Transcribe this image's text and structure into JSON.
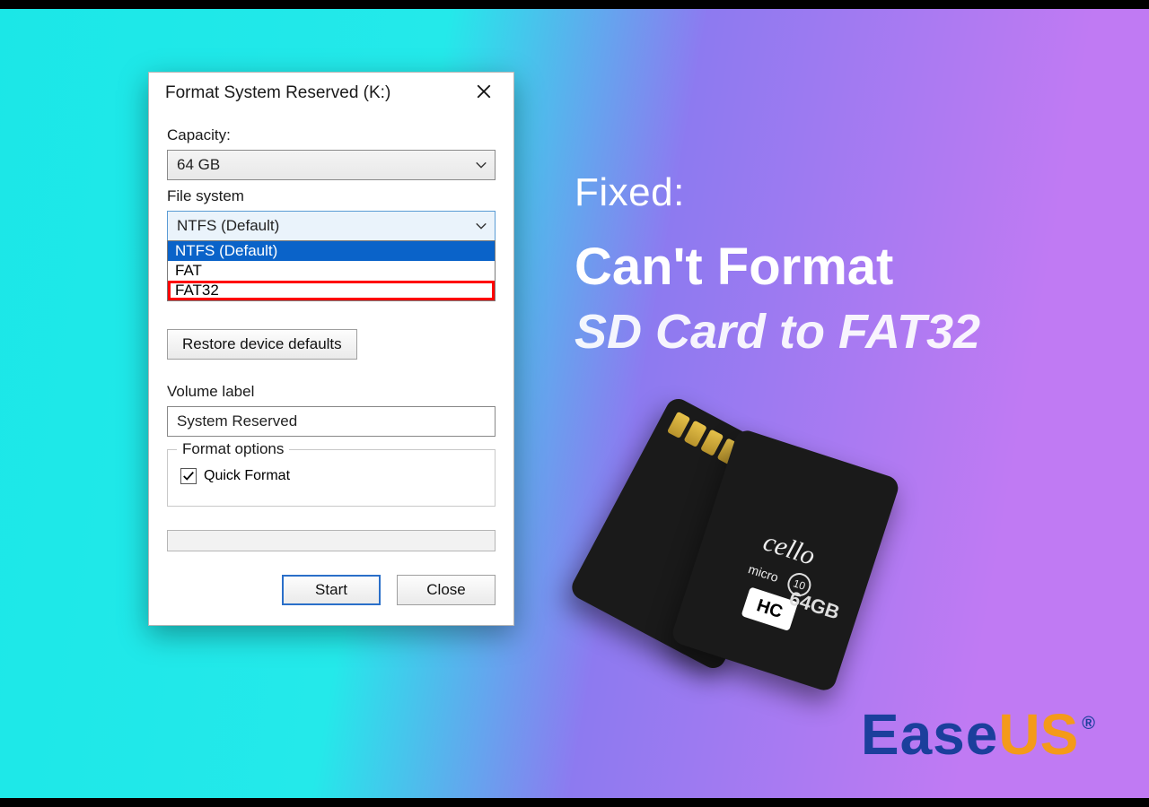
{
  "dialog": {
    "title": "Format System Reserved (K:)",
    "capacity_label": "Capacity:",
    "capacity_value": "64 GB",
    "filesystem_label": "File system",
    "filesystem_selected": "NTFS (Default)",
    "filesystem_options": [
      "NTFS (Default)",
      "FAT",
      "FAT32"
    ],
    "restore_btn": "Restore device defaults",
    "volume_label_label": "Volume label",
    "volume_label_value": "System Reserved",
    "format_options_label": "Format options",
    "quick_format_label": "Quick Format",
    "quick_format_checked": true,
    "start_btn": "Start",
    "close_btn": "Close"
  },
  "headline": {
    "line1": "Fixed:",
    "line2": "Can't Format",
    "line3": "SD Card to FAT32"
  },
  "sdcard": {
    "brand": "cello",
    "micro": "micro",
    "class": "10",
    "hc": "HC",
    "capacity": "64GB"
  },
  "logo": {
    "part1": "Ease",
    "part2": "US",
    "reg": "®"
  }
}
